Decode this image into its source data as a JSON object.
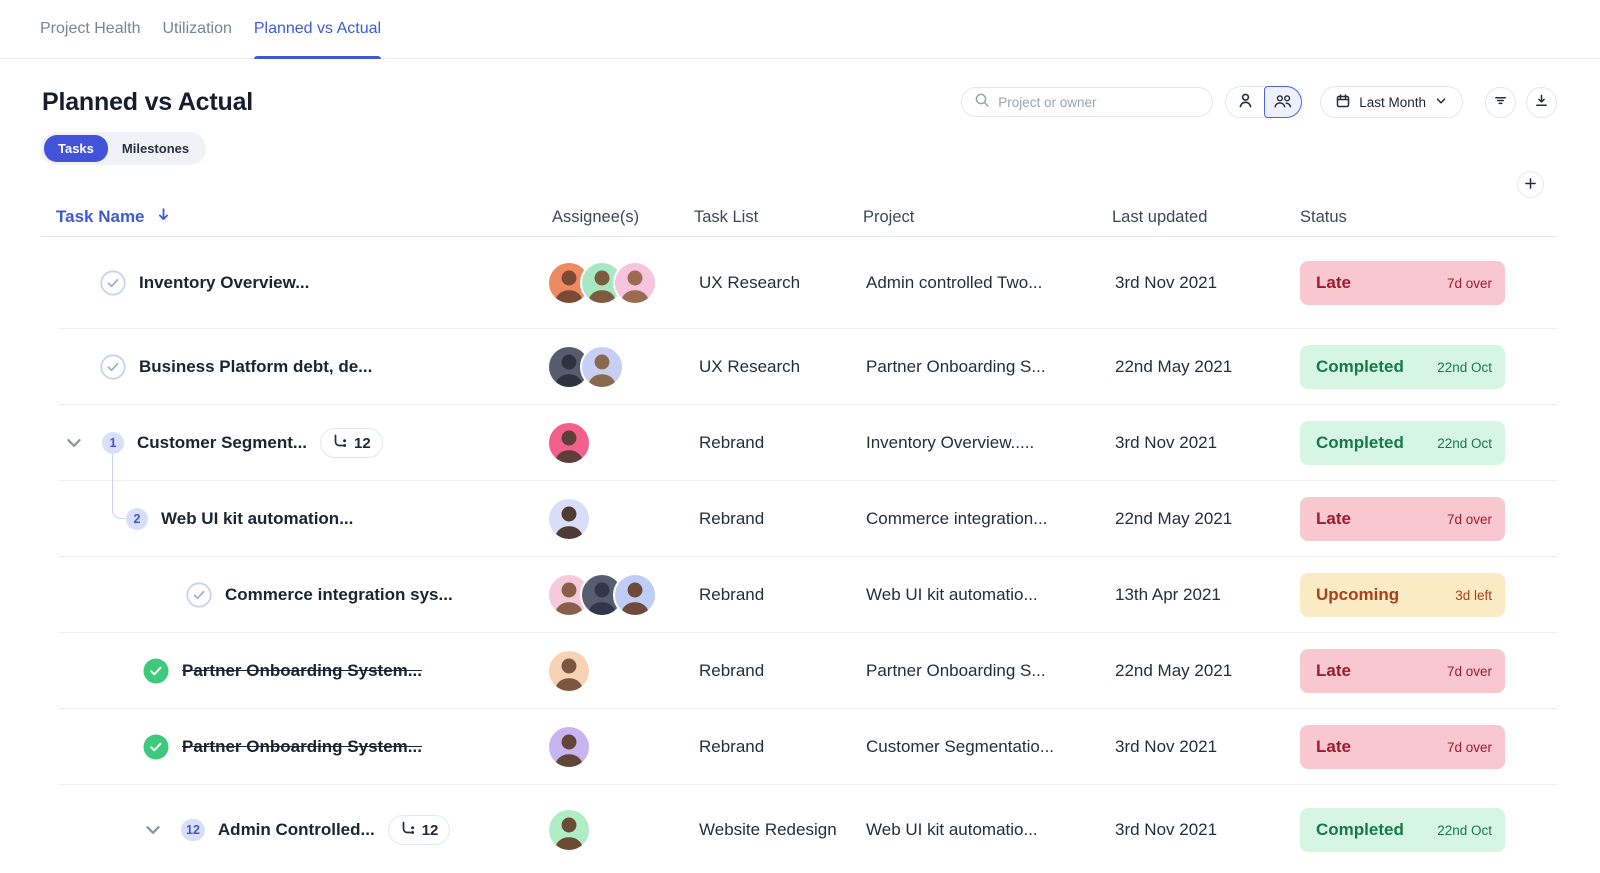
{
  "page": {
    "title": "Planned vs Actual"
  },
  "tabs": [
    {
      "label": "Project Health",
      "active": false
    },
    {
      "label": "Utilization",
      "active": false
    },
    {
      "label": "Planned vs Actual",
      "active": true
    }
  ],
  "toggle": [
    {
      "label": "Tasks",
      "active": true
    },
    {
      "label": "Milestones",
      "active": false
    }
  ],
  "toolbar": {
    "search_placeholder": "Project or owner",
    "date_filter": "Last Month",
    "icons": [
      "search-icon",
      "person-icon",
      "people-group-icon",
      "calendar-icon",
      "chevron-down-icon",
      "filter-icon",
      "download-icon",
      "plus-icon",
      "sort-descending-icon"
    ]
  },
  "colors": {
    "accent": "#3D5BD9",
    "toggle_active": "#4353D9",
    "late_bg": "#F8C7D0",
    "late_text": "#9E1A2E",
    "completed_bg": "#D6F6E3",
    "completed_text": "#15794A",
    "upcoming_bg": "#FBEBC5",
    "upcoming_text": "#A64119"
  },
  "table": {
    "headers": {
      "task": "Task Name",
      "assignees": "Assignee(s)",
      "task_list": "Task List",
      "project": "Project",
      "last_updated": "Last updated",
      "status": "Status"
    },
    "connector": true,
    "rows": [
      {
        "leading": "check",
        "indent": "a",
        "name": "Inventory Overview...",
        "struck": false,
        "avatars": [
          {
            "bg": "#EE8A61",
            "tone": "#7A4A33"
          },
          {
            "bg": "#A7E8C3",
            "tone": "#7D5B3F"
          },
          {
            "bg": "#F6C4DC",
            "tone": "#9C6B4F"
          }
        ],
        "task_list": "UX Research",
        "project": "Admin controlled Two...",
        "updated": "3rd Nov 2021",
        "status": {
          "type": "late",
          "label": "Late",
          "detail": "7d over"
        }
      },
      {
        "leading": "check",
        "indent": "a",
        "name": "Business Platform debt, de...",
        "struck": false,
        "avatars": [
          {
            "bg": "#575B6E",
            "tone": "#2E3140"
          },
          {
            "bg": "#C7CFF4",
            "tone": "#8A6A4E"
          }
        ],
        "task_list": "UX Research",
        "project": "Partner Onboarding S...",
        "updated": "22nd May 2021",
        "status": {
          "type": "completed",
          "label": "Completed",
          "detail": "22nd Oct"
        }
      },
      {
        "leading": "chevron",
        "indent": "b",
        "num": "1",
        "name": "Customer Segment...",
        "subtasks": "12",
        "struck": false,
        "avatars": [
          {
            "bg": "#F2608B",
            "tone": "#5A3F3A"
          }
        ],
        "task_list": "Rebrand",
        "project": "Inventory Overview.....",
        "updated": "3rd Nov 2021",
        "status": {
          "type": "completed",
          "label": "Completed",
          "detail": "22nd Oct"
        }
      },
      {
        "leading": "num",
        "indent": "c",
        "num": "2",
        "name": "Web UI kit automation...",
        "struck": false,
        "avatars": [
          {
            "bg": "#D8DDF8",
            "tone": "#4F3B33"
          }
        ],
        "task_list": "Rebrand",
        "project": "Commerce integration...",
        "updated": "22nd May 2021",
        "status": {
          "type": "late",
          "label": "Late",
          "detail": "7d over"
        }
      },
      {
        "leading": "check",
        "indent": "d",
        "name": "Commerce integration sys...",
        "struck": false,
        "avatars": [
          {
            "bg": "#F6C9DB",
            "tone": "#8A5F4A"
          },
          {
            "bg": "#585C70",
            "tone": "#33364A"
          },
          {
            "bg": "#BFCCF5",
            "tone": "#6E4A3A"
          }
        ],
        "task_list": "Rebrand",
        "project": "Web UI kit automatio...",
        "updated": "13th Apr 2021",
        "status": {
          "type": "upcoming",
          "label": "Upcoming",
          "detail": "3d left"
        }
      },
      {
        "leading": "done",
        "indent": "e",
        "name": "Partner Onboarding System...",
        "struck": true,
        "avatars": [
          {
            "bg": "#F8D2B4",
            "tone": "#7D5640"
          }
        ],
        "task_list": "Rebrand",
        "project": "Partner Onboarding S...",
        "updated": "22nd May 2021",
        "status": {
          "type": "late",
          "label": "Late",
          "detail": "7d over"
        }
      },
      {
        "leading": "done",
        "indent": "e",
        "name": "Partner Onboarding System...",
        "struck": true,
        "avatars": [
          {
            "bg": "#C8B4F0",
            "tone": "#5F4636"
          }
        ],
        "task_list": "Rebrand",
        "project": "Customer Segmentatio...",
        "updated": "3rd Nov 2021",
        "status": {
          "type": "late",
          "label": "Late",
          "detail": "7d over"
        }
      },
      {
        "leading": "chevron",
        "indent": "e",
        "num": "12",
        "name": "Admin Controlled...",
        "subtasks": "12",
        "struck": false,
        "avatars": [
          {
            "bg": "#AFEDC6",
            "tone": "#6B4A36"
          }
        ],
        "task_list": "Website Redesign",
        "project": "Web UI kit automatio...",
        "updated": "3rd Nov 2021",
        "status": {
          "type": "completed",
          "label": "Completed",
          "detail": "22nd Oct"
        }
      }
    ]
  }
}
